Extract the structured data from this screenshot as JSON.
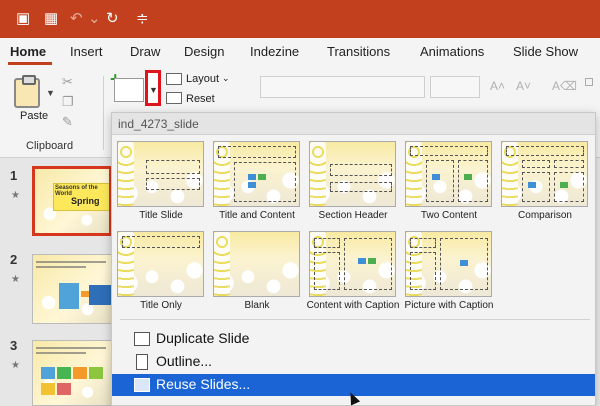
{
  "titlebar": {
    "icons": [
      "sidebar-icon",
      "save-icon",
      "undo-icon",
      "redo-icon",
      "customize-icon"
    ]
  },
  "tabs": [
    "Home",
    "Insert",
    "Draw",
    "Design",
    "Indezine",
    "Transitions",
    "Animations",
    "Slide Show"
  ],
  "ribbon": {
    "paste_label": "Paste",
    "clipboard_label": "Clipboard",
    "layout_label": "Layout",
    "reset_label": "Reset"
  },
  "slides": [
    {
      "num": "1",
      "title": "Seasons of the World",
      "subtitle": "Spring"
    },
    {
      "num": "2"
    },
    {
      "num": "3"
    }
  ],
  "gallery": {
    "title": "ind_4273_slide",
    "layouts": [
      "Title Slide",
      "Title and Content",
      "Section Header",
      "Two Content",
      "Comparison",
      "Title Only",
      "Blank",
      "Content with Caption",
      "Picture with Caption"
    ],
    "menu": [
      "Duplicate Slide",
      "Outline...",
      "Reuse Slides..."
    ]
  },
  "colors": {
    "accent": "#c2401e",
    "highlight": "#1a64d6",
    "callout": "#e0141c"
  }
}
